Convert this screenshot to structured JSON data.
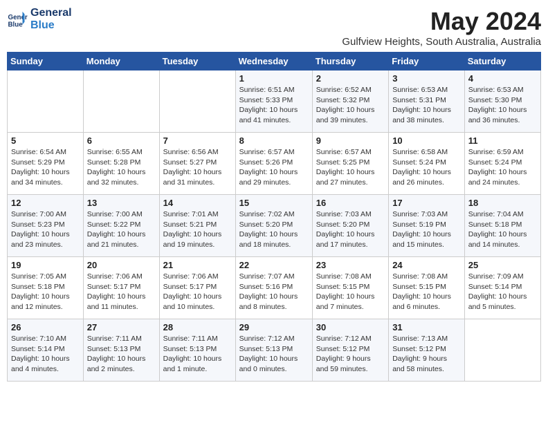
{
  "header": {
    "logo_line1": "General",
    "logo_line2": "Blue",
    "month": "May 2024",
    "location": "Gulfview Heights, South Australia, Australia"
  },
  "weekdays": [
    "Sunday",
    "Monday",
    "Tuesday",
    "Wednesday",
    "Thursday",
    "Friday",
    "Saturday"
  ],
  "weeks": [
    [
      {
        "day": "",
        "info": ""
      },
      {
        "day": "",
        "info": ""
      },
      {
        "day": "",
        "info": ""
      },
      {
        "day": "1",
        "info": "Sunrise: 6:51 AM\nSunset: 5:33 PM\nDaylight: 10 hours\nand 41 minutes."
      },
      {
        "day": "2",
        "info": "Sunrise: 6:52 AM\nSunset: 5:32 PM\nDaylight: 10 hours\nand 39 minutes."
      },
      {
        "day": "3",
        "info": "Sunrise: 6:53 AM\nSunset: 5:31 PM\nDaylight: 10 hours\nand 38 minutes."
      },
      {
        "day": "4",
        "info": "Sunrise: 6:53 AM\nSunset: 5:30 PM\nDaylight: 10 hours\nand 36 minutes."
      }
    ],
    [
      {
        "day": "5",
        "info": "Sunrise: 6:54 AM\nSunset: 5:29 PM\nDaylight: 10 hours\nand 34 minutes."
      },
      {
        "day": "6",
        "info": "Sunrise: 6:55 AM\nSunset: 5:28 PM\nDaylight: 10 hours\nand 32 minutes."
      },
      {
        "day": "7",
        "info": "Sunrise: 6:56 AM\nSunset: 5:27 PM\nDaylight: 10 hours\nand 31 minutes."
      },
      {
        "day": "8",
        "info": "Sunrise: 6:57 AM\nSunset: 5:26 PM\nDaylight: 10 hours\nand 29 minutes."
      },
      {
        "day": "9",
        "info": "Sunrise: 6:57 AM\nSunset: 5:25 PM\nDaylight: 10 hours\nand 27 minutes."
      },
      {
        "day": "10",
        "info": "Sunrise: 6:58 AM\nSunset: 5:24 PM\nDaylight: 10 hours\nand 26 minutes."
      },
      {
        "day": "11",
        "info": "Sunrise: 6:59 AM\nSunset: 5:24 PM\nDaylight: 10 hours\nand 24 minutes."
      }
    ],
    [
      {
        "day": "12",
        "info": "Sunrise: 7:00 AM\nSunset: 5:23 PM\nDaylight: 10 hours\nand 23 minutes."
      },
      {
        "day": "13",
        "info": "Sunrise: 7:00 AM\nSunset: 5:22 PM\nDaylight: 10 hours\nand 21 minutes."
      },
      {
        "day": "14",
        "info": "Sunrise: 7:01 AM\nSunset: 5:21 PM\nDaylight: 10 hours\nand 19 minutes."
      },
      {
        "day": "15",
        "info": "Sunrise: 7:02 AM\nSunset: 5:20 PM\nDaylight: 10 hours\nand 18 minutes."
      },
      {
        "day": "16",
        "info": "Sunrise: 7:03 AM\nSunset: 5:20 PM\nDaylight: 10 hours\nand 17 minutes."
      },
      {
        "day": "17",
        "info": "Sunrise: 7:03 AM\nSunset: 5:19 PM\nDaylight: 10 hours\nand 15 minutes."
      },
      {
        "day": "18",
        "info": "Sunrise: 7:04 AM\nSunset: 5:18 PM\nDaylight: 10 hours\nand 14 minutes."
      }
    ],
    [
      {
        "day": "19",
        "info": "Sunrise: 7:05 AM\nSunset: 5:18 PM\nDaylight: 10 hours\nand 12 minutes."
      },
      {
        "day": "20",
        "info": "Sunrise: 7:06 AM\nSunset: 5:17 PM\nDaylight: 10 hours\nand 11 minutes."
      },
      {
        "day": "21",
        "info": "Sunrise: 7:06 AM\nSunset: 5:17 PM\nDaylight: 10 hours\nand 10 minutes."
      },
      {
        "day": "22",
        "info": "Sunrise: 7:07 AM\nSunset: 5:16 PM\nDaylight: 10 hours\nand 8 minutes."
      },
      {
        "day": "23",
        "info": "Sunrise: 7:08 AM\nSunset: 5:15 PM\nDaylight: 10 hours\nand 7 minutes."
      },
      {
        "day": "24",
        "info": "Sunrise: 7:08 AM\nSunset: 5:15 PM\nDaylight: 10 hours\nand 6 minutes."
      },
      {
        "day": "25",
        "info": "Sunrise: 7:09 AM\nSunset: 5:14 PM\nDaylight: 10 hours\nand 5 minutes."
      }
    ],
    [
      {
        "day": "26",
        "info": "Sunrise: 7:10 AM\nSunset: 5:14 PM\nDaylight: 10 hours\nand 4 minutes."
      },
      {
        "day": "27",
        "info": "Sunrise: 7:11 AM\nSunset: 5:13 PM\nDaylight: 10 hours\nand 2 minutes."
      },
      {
        "day": "28",
        "info": "Sunrise: 7:11 AM\nSunset: 5:13 PM\nDaylight: 10 hours\nand 1 minute."
      },
      {
        "day": "29",
        "info": "Sunrise: 7:12 AM\nSunset: 5:13 PM\nDaylight: 10 hours\nand 0 minutes."
      },
      {
        "day": "30",
        "info": "Sunrise: 7:12 AM\nSunset: 5:12 PM\nDaylight: 9 hours\nand 59 minutes."
      },
      {
        "day": "31",
        "info": "Sunrise: 7:13 AM\nSunset: 5:12 PM\nDaylight: 9 hours\nand 58 minutes."
      },
      {
        "day": "",
        "info": ""
      }
    ]
  ]
}
